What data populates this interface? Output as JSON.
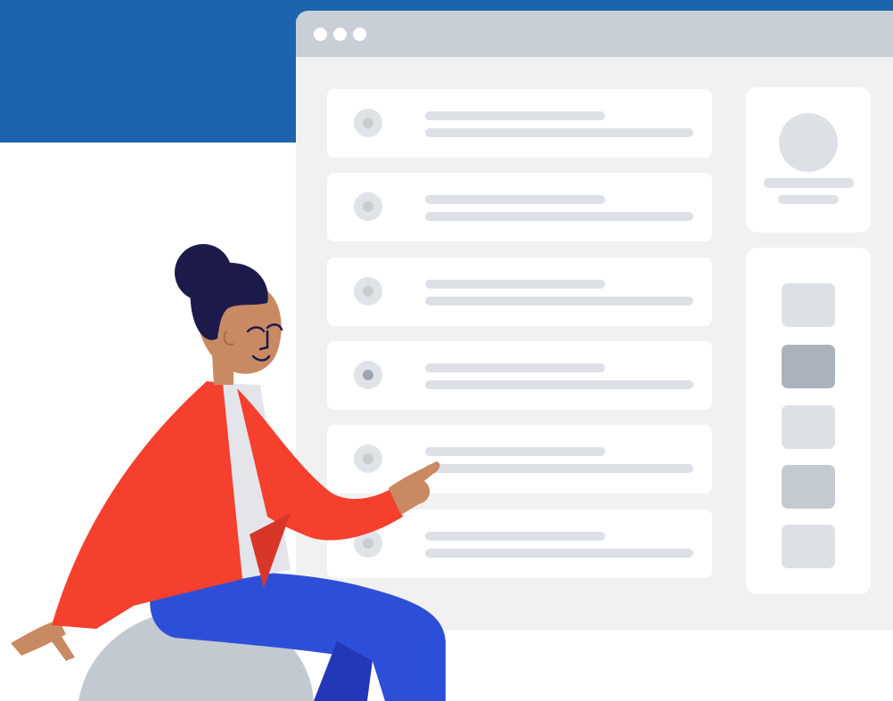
{
  "colors": {
    "header_band": "#1c64ae",
    "window_bg": "#f1f1f2",
    "titlebar": "#c9cfd7",
    "card_bg": "#ffffff",
    "skeleton": "#dde1e6",
    "jacket": "#f5402e",
    "pants": "#2d4fd8",
    "hair": "#1c1a4a",
    "skin": "#c98a63",
    "exercise_ball": "#c3c9d1"
  },
  "window": {
    "titlebar_dots": [
      "dot",
      "dot",
      "dot"
    ]
  },
  "list_rows": [
    {
      "radio": "unselected"
    },
    {
      "radio": "unselected"
    },
    {
      "radio": "unselected"
    },
    {
      "radio": "selected"
    },
    {
      "radio": "unselected"
    },
    {
      "radio": "unselected"
    }
  ],
  "profile_card": {
    "avatar_icon": "user-avatar-placeholder"
  },
  "swatches": [
    {
      "color": "#dde1e6"
    },
    {
      "color": "#aab3bc"
    },
    {
      "color": "#dde1e6"
    },
    {
      "color": "#c3cad2"
    },
    {
      "color": "#dde1e6"
    }
  ],
  "illustration": {
    "subject": "woman-pointing-icon",
    "seat": "exercise-ball-icon"
  }
}
